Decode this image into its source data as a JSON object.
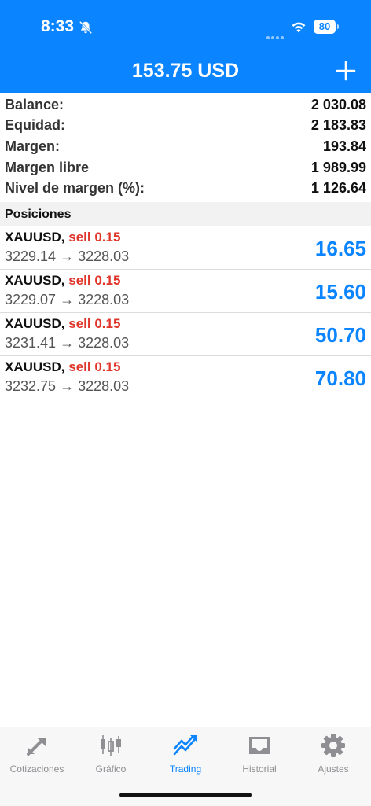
{
  "status_bar": {
    "time": "8:33",
    "battery": "80"
  },
  "header": {
    "title": "153.75 USD"
  },
  "summary": [
    {
      "label": "Balance:",
      "value": "2 030.08"
    },
    {
      "label": "Equidad:",
      "value": "2 183.83"
    },
    {
      "label": "Margen:",
      "value": "193.84"
    },
    {
      "label": "Margen libre",
      "value": "1 989.99"
    },
    {
      "label": "Nivel de margen (%):",
      "value": "1 126.64"
    }
  ],
  "positions_section": {
    "title": "Posiciones"
  },
  "positions": [
    {
      "symbol": "XAUUSD",
      "side": "sell 0.15",
      "prices": "3229.14 → 3228.03",
      "profit": "16.65"
    },
    {
      "symbol": "XAUUSD",
      "side": "sell 0.15",
      "prices": "3229.07 → 3228.03",
      "profit": "15.60"
    },
    {
      "symbol": "XAUUSD",
      "side": "sell 0.15",
      "prices": "3231.41 → 3228.03",
      "profit": "50.70"
    },
    {
      "symbol": "XAUUSD",
      "side": "sell 0.15",
      "prices": "3232.75 → 3228.03",
      "profit": "70.80"
    }
  ],
  "tabs": [
    {
      "label": "Cotizaciones",
      "icon": "quotes-icon"
    },
    {
      "label": "Gráfico",
      "icon": "candlestick-chart-icon"
    },
    {
      "label": "Trading",
      "icon": "trading-trend-icon"
    },
    {
      "label": "Historial",
      "icon": "inbox-tray-icon"
    },
    {
      "label": "Ajustes",
      "icon": "gear-icon"
    }
  ],
  "active_tab": "Trading",
  "colors": {
    "accent": "#0a84ff",
    "sell": "#e0352b",
    "tab_inactive": "#8e8e93"
  }
}
